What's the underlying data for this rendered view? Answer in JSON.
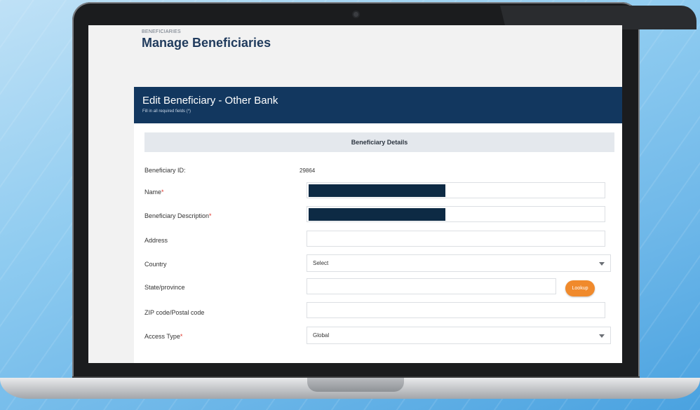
{
  "breadcrumb": "BENEFICIARIES",
  "page_title": "Manage Beneficiaries",
  "edit_panel": {
    "title": "Edit Beneficiary - Other Bank",
    "subtitle": "Fill in all required fields (*)"
  },
  "section_title": "Beneficiary Details",
  "required_marker": "*",
  "fields": {
    "beneficiary_id": {
      "label": "Beneficiary ID:",
      "value": "29864"
    },
    "name": {
      "label": "Name",
      "required": true
    },
    "description": {
      "label": "Beneficiary Description",
      "required": true
    },
    "address": {
      "label": "Address"
    },
    "country": {
      "label": "Country",
      "selected": "Select"
    },
    "state": {
      "label": "State/province"
    },
    "zip": {
      "label": "ZIP code/Postal code"
    },
    "access_type": {
      "label": "Access Type",
      "required": true,
      "selected": "Global"
    }
  },
  "lookup_label": "Lookup",
  "colors": {
    "header_bg": "#12375f",
    "title": "#1f3a5c",
    "required": "#e0342b",
    "lookup_button": "#f08a2c",
    "redaction": "#0d2a44"
  },
  "icons": {
    "dropdown": "chevron-down-icon",
    "camera": "camera-icon"
  }
}
